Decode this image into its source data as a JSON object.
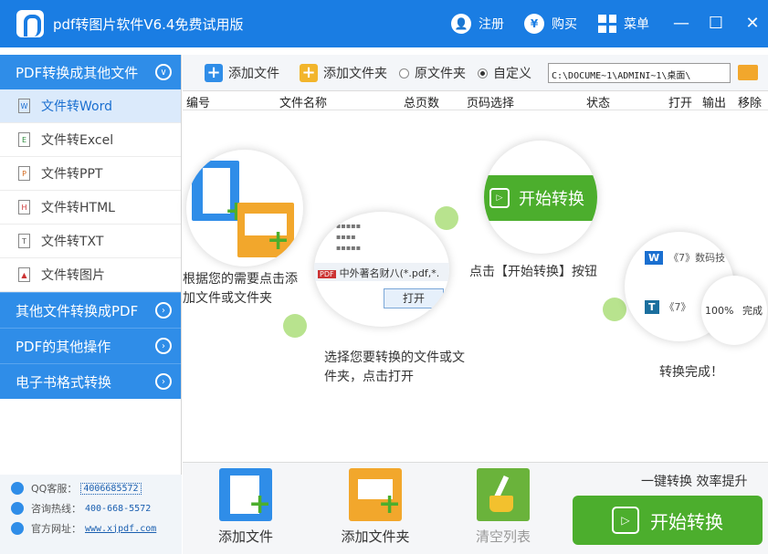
{
  "app": {
    "title": "pdf转图片软件V6.4免费试用版",
    "register": "注册",
    "buy": "购买",
    "menu": "菜单",
    "minimize": "—",
    "maximize": "☐",
    "close": "✕"
  },
  "sidebar": {
    "header": "PDF转换成其他文件",
    "items": [
      {
        "label": "文件转Word",
        "icon": "W"
      },
      {
        "label": "文件转Excel",
        "icon": "E"
      },
      {
        "label": "文件转PPT",
        "icon": "P"
      },
      {
        "label": "文件转HTML",
        "icon": "H"
      },
      {
        "label": "文件转TXT",
        "icon": "T"
      },
      {
        "label": "文件转图片",
        "icon": "▲"
      }
    ],
    "groups": [
      "其他文件转换成PDF",
      "PDF的其他操作",
      "电子书格式转换"
    ],
    "contact": {
      "qq_label": "QQ客服：",
      "qq_value": "4006685572",
      "hotline_label": "咨询热线：",
      "hotline_value": "400-668-5572",
      "website_label": "官方网址：",
      "website_value": "www.xjpdf.com"
    }
  },
  "toolbar": {
    "add_file": "添加文件",
    "add_folder": "添加文件夹",
    "source_folder": "原文件夹",
    "custom": "自定义",
    "path_value": "C:\\DOCUME~1\\ADMINI~1\\桌面\\"
  },
  "table": {
    "columns": [
      "编号",
      "文件名称",
      "总页数",
      "页码选择",
      "状态",
      "打开",
      "输出",
      "移除"
    ]
  },
  "steps": {
    "step1": "根据您的需要点击添加文件或文件夹",
    "step2": "选择您要转换的文件或文件夹，点击打开",
    "step3": "点击【开始转换】按钮",
    "step4": "转换完成！",
    "dialog_filename": "中外著名财",
    "dialog_filter": "八(*.pdf,*.",
    "dialog_open": "打开",
    "bubble_start": "开始转换",
    "result_w": "《7》数码技",
    "result_t": "《7》",
    "result_percent": "100%",
    "result_done": "完成"
  },
  "bottom": {
    "add_file": "添加文件",
    "add_folder": "添加文件夹",
    "clear_list": "清空列表",
    "slogan": "一键转换 效率提升",
    "start": "开始转换"
  }
}
